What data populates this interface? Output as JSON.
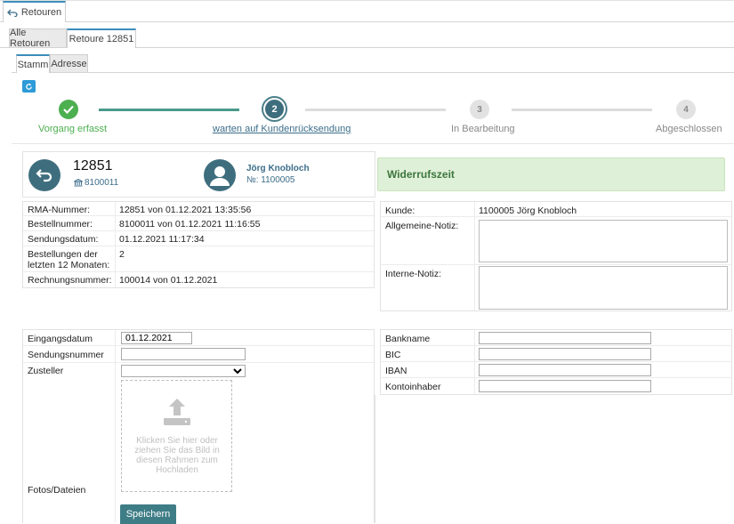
{
  "top_tab": {
    "label": "Retouren"
  },
  "sub_tabs": [
    {
      "label": "Alle Retouren"
    },
    {
      "label": "Retoure 12851"
    }
  ],
  "inner_tabs": [
    {
      "label": "Stamm"
    },
    {
      "label": "Adresse"
    }
  ],
  "steps": [
    {
      "label": "Vorgang erfasst",
      "status": "done"
    },
    {
      "number": "2",
      "label": "warten auf Kundenrücksendung",
      "status": "active"
    },
    {
      "number": "3",
      "label": "In Bearbeitung",
      "status": "pending"
    },
    {
      "number": "4",
      "label": "Abgeschlossen",
      "status": "pending"
    }
  ],
  "header": {
    "rma_number": "12851",
    "order_ref": "8100011",
    "customer_name": "Jörg Knobloch",
    "customer_no": "№: 1100005",
    "status_box": "Widerrufszeit"
  },
  "left_info": [
    {
      "label": "RMA-Nummer:",
      "value": "12851 von 01.12.2021 13:35:56"
    },
    {
      "label": "Bestellnummer:",
      "value": "8100011 von 01.12.2021 11:16:55"
    },
    {
      "label": "Sendungsdatum:",
      "value": "01.12.2021 11:17:34"
    },
    {
      "label": "Bestellungen der letzten 12 Monaten:",
      "value": "2"
    },
    {
      "label": "Rechnungsnummer:",
      "value": "100014 von 01.12.2021"
    }
  ],
  "right_info": {
    "customer_label": "Kunde:",
    "customer_value": "1100005 Jörg Knobloch",
    "general_note_label": "Allgemeine-Notiz:",
    "internal_note_label": "Interne-Notiz:"
  },
  "form_left": {
    "receipt_date_label": "Eingangsdatum",
    "receipt_date_value": "01.12.2021",
    "tracking_label": "Sendungsnummer",
    "carrier_label": "Zusteller",
    "files_label": "Fotos/Dateien",
    "upload_text": "Klicken Sie hier oder ziehen Sie das Bild in diesen Rahmen zum Hochladen",
    "save_label": "Speichern"
  },
  "form_right": {
    "bank_label": "Bankname",
    "bic_label": "BIC",
    "iban_label": "IBAN",
    "holder_label": "Kontoinhaber"
  },
  "colors": {
    "accent": "#3c8dbc",
    "done": "#4caf50",
    "avatar": "#3e6e7e",
    "status_bg": "#dff0d8",
    "status_text": "#3c763d",
    "save_btn": "#3e7d86"
  }
}
